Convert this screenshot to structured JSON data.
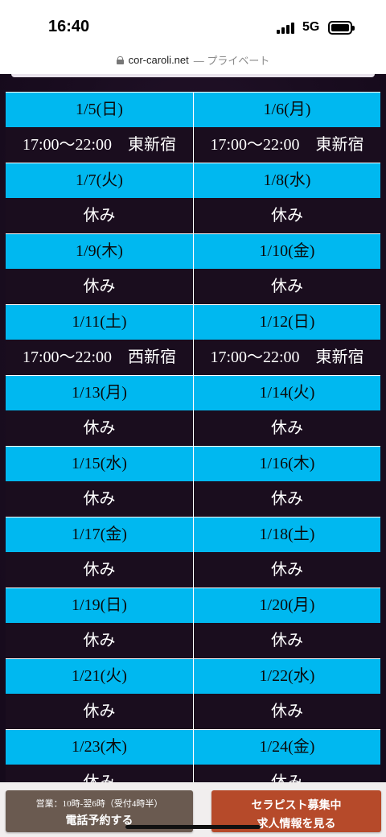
{
  "status_bar": {
    "time": "16:40",
    "network": "5G",
    "icons": [
      "signal-bars-icon",
      "battery-icon"
    ]
  },
  "url_bar": {
    "domain": "cor-caroli.net",
    "suffix": "— プライベート",
    "icon": "lock-icon"
  },
  "schedule": {
    "rows": [
      {
        "left": {
          "date": "1/5(日)",
          "info": "17:00〜22:00　東新宿"
        },
        "right": {
          "date": "1/6(月)",
          "info": "17:00〜22:00　東新宿"
        }
      },
      {
        "left": {
          "date": "1/7(火)",
          "info": "休み"
        },
        "right": {
          "date": "1/8(水)",
          "info": "休み"
        }
      },
      {
        "left": {
          "date": "1/9(木)",
          "info": "休み"
        },
        "right": {
          "date": "1/10(金)",
          "info": "休み"
        }
      },
      {
        "left": {
          "date": "1/11(土)",
          "info": "17:00〜22:00　西新宿"
        },
        "right": {
          "date": "1/12(日)",
          "info": "17:00〜22:00　東新宿"
        }
      },
      {
        "left": {
          "date": "1/13(月)",
          "info": "休み"
        },
        "right": {
          "date": "1/14(火)",
          "info": "休み"
        }
      },
      {
        "left": {
          "date": "1/15(水)",
          "info": "休み"
        },
        "right": {
          "date": "1/16(木)",
          "info": "休み"
        }
      },
      {
        "left": {
          "date": "1/17(金)",
          "info": "休み"
        },
        "right": {
          "date": "1/18(土)",
          "info": "休み"
        }
      },
      {
        "left": {
          "date": "1/19(日)",
          "info": "休み"
        },
        "right": {
          "date": "1/20(月)",
          "info": "休み"
        }
      },
      {
        "left": {
          "date": "1/21(火)",
          "info": "休み"
        },
        "right": {
          "date": "1/22(水)",
          "info": "休み"
        }
      },
      {
        "left": {
          "date": "1/23(木)",
          "info": "休み"
        },
        "right": {
          "date": "1/24(金)",
          "info": "休み"
        }
      }
    ]
  },
  "bottom_bar": {
    "call_button": {
      "hours": "営業：10時-翌6時（受付4時半）",
      "label": "電話予約する"
    },
    "recruit_button": {
      "line1": "セラピスト募集中",
      "line2": "求人情報を見る"
    }
  },
  "colors": {
    "date_cell_bg": "#00b8f0",
    "info_cell_bg": "#1a0d1e",
    "call_button_bg": "#6a5a50",
    "recruit_button_bg": "#b64a2a"
  }
}
